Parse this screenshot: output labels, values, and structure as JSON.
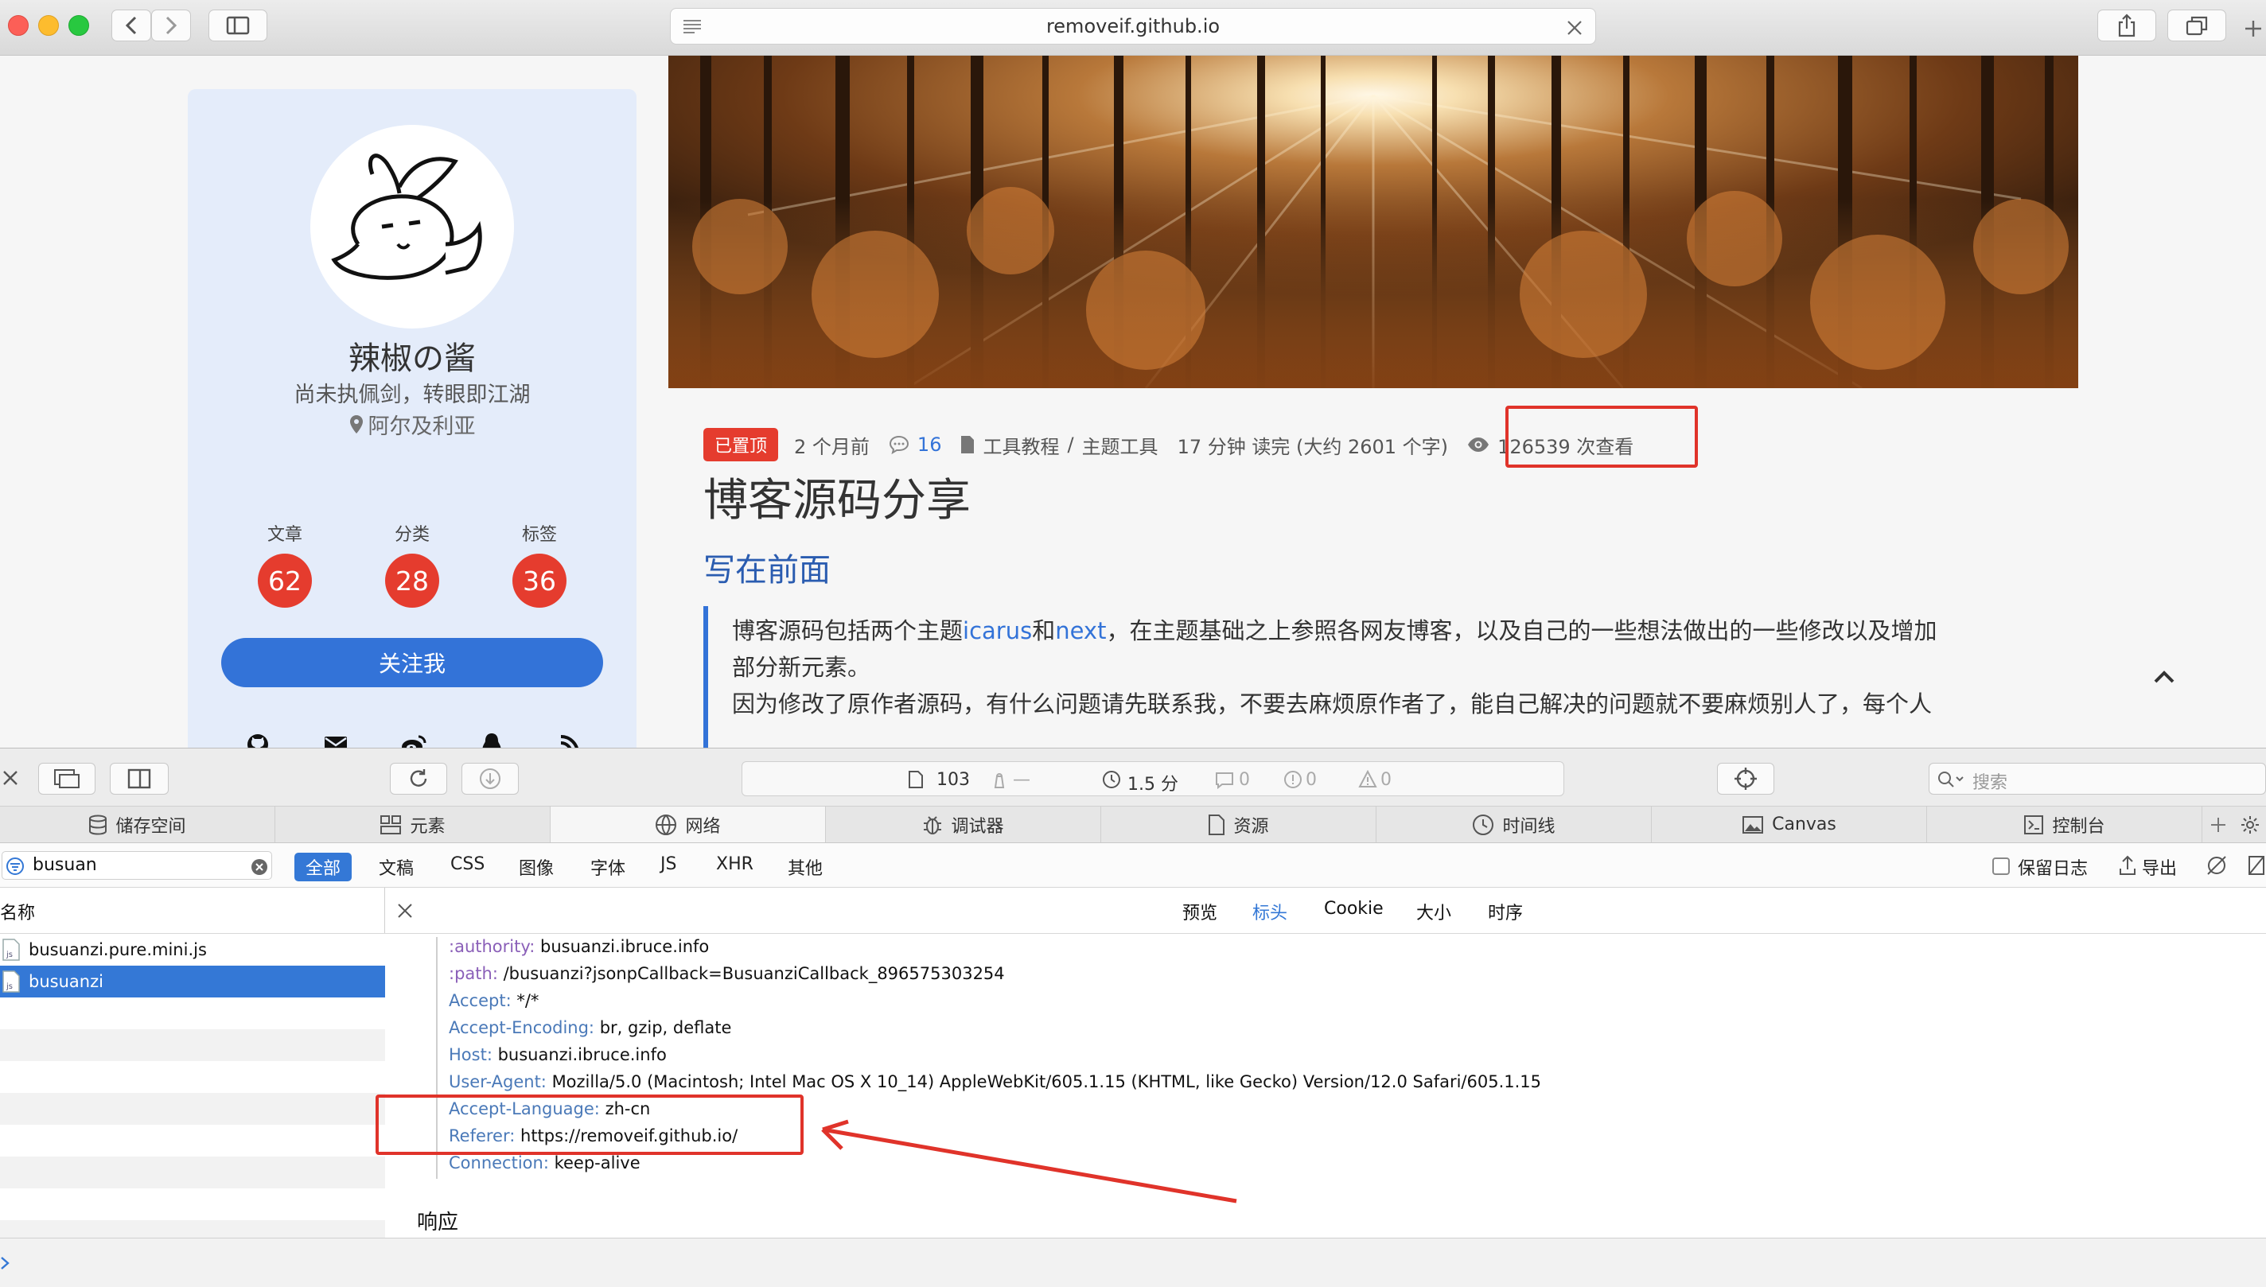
{
  "browser": {
    "url": "removeif.github.io"
  },
  "profile": {
    "name": "辣椒の酱",
    "motto": "尚未执佩剑，转眼即江湖",
    "location": "阿尔及利亚",
    "stats": [
      {
        "label": "文章",
        "value": "62"
      },
      {
        "label": "分类",
        "value": "28"
      },
      {
        "label": "标签",
        "value": "36"
      }
    ],
    "follow_label": "关注我"
  },
  "article": {
    "pinned_badge": "已置顶",
    "time_ago": "2 个月前",
    "comments": "16",
    "category_1": "工具教程",
    "category_sep": "/",
    "category_2": "主题工具",
    "read_time": "17 分钟 读完 (大约 2601 个字)",
    "views": "126539 次查看",
    "title": "博客源码分享",
    "section_title": "写在前面",
    "quote_part1": "博客源码包括两个主题",
    "quote_link1": "icarus",
    "quote_and": "和",
    "quote_link2": "next",
    "quote_part2": "，在主题基础之上参照各网友博客，以及自己的一些想法做出的一些修改以及增加",
    "quote_line2": "部分新元素。",
    "quote_line3": "因为修改了原作者源码，有什么问题请先联系我，不要去麻烦原作者了，能自己解决的问题就不要麻烦别人了，每个人"
  },
  "devtools": {
    "summary": {
      "resources": "103",
      "size": "—",
      "time": "1.5 分",
      "messages": "0",
      "errors": "0",
      "warnings": "0"
    },
    "search_placeholder": "搜索",
    "tabs": [
      "储存空间",
      "元素",
      "网络",
      "调试器",
      "资源",
      "时间线",
      "Canvas",
      "控制台"
    ],
    "filter_value": "busuan",
    "filter_types": [
      "全部",
      "文稿",
      "CSS",
      "图像",
      "字体",
      "JS",
      "XHR",
      "其他"
    ],
    "preserve_log": "保留日志",
    "export": "导出",
    "list_header": "名称",
    "requests": [
      {
        "name": "busuanzi.pure.mini.js",
        "icon": "js"
      },
      {
        "name": "busuanzi",
        "icon": "js"
      }
    ],
    "detail_tabs": [
      "预览",
      "标头",
      "Cookie",
      "大小",
      "时序"
    ],
    "headers": [
      {
        "key": ":authority:",
        "value": "busuanzi.ibruce.info"
      },
      {
        "key": ":path:",
        "value": "/busuanzi?jsonpCallback=BusuanziCallback_896575303254"
      },
      {
        "key": "Accept:",
        "value": "*/*"
      },
      {
        "key": "Accept-Encoding:",
        "value": "br, gzip, deflate"
      },
      {
        "key": "Host:",
        "value": "busuanzi.ibruce.info"
      },
      {
        "key": "User-Agent:",
        "value": "Mozilla/5.0 (Macintosh; Intel Mac OS X 10_14) AppleWebKit/605.1.15 (KHTML, like Gecko) Version/12.0 Safari/605.1.15"
      },
      {
        "key": "Accept-Language:",
        "value": "zh-cn"
      },
      {
        "key": "Referer:",
        "value": "https://removeif.github.io/"
      },
      {
        "key": "Connection:",
        "value": "keep-alive"
      }
    ],
    "response_label": "响应"
  },
  "colors": {
    "accent_blue": "#3373d8",
    "badge_red": "#e53c2e",
    "annotation_red": "#e0332a",
    "selected_row": "#3478d6"
  }
}
